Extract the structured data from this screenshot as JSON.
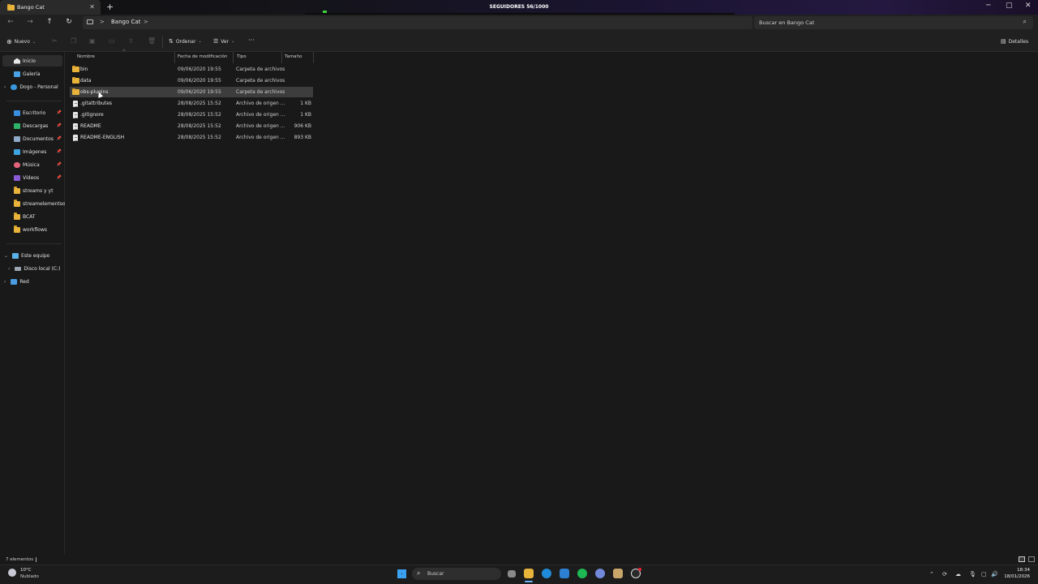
{
  "window": {
    "tab_title": "Bango Cat",
    "overlay_title": "SEGUIDORES 56/1000",
    "new_tab": "+",
    "tab_close": "✕",
    "minimize": "─",
    "maximize": "▢",
    "close": "✕"
  },
  "address": {
    "breadcrumb_sep1": ">",
    "breadcrumb_folder": "Bango Cat",
    "breadcrumb_sep2": ">",
    "search_placeholder": "Buscar en Bango Cat"
  },
  "toolbar": {
    "new_label": "Nuevo",
    "sort_label": "Ordenar",
    "view_label": "Ver",
    "more_label": "···",
    "details_label": "Detalles"
  },
  "sidebar": {
    "home": "Inicio",
    "gallery": "Galería",
    "onedrive": "Dogo - Personal",
    "quick": [
      {
        "label": "Escritorio",
        "pinned": true,
        "icon": "desktop-icon"
      },
      {
        "label": "Descargas",
        "pinned": true,
        "icon": "download-icon"
      },
      {
        "label": "Documentos",
        "pinned": true,
        "icon": "documents-icon"
      },
      {
        "label": "Imágenes",
        "pinned": true,
        "icon": "pictures-icon"
      },
      {
        "label": "Música",
        "pinned": true,
        "icon": "music-icon"
      },
      {
        "label": "Vídeos",
        "pinned": true,
        "icon": "videos-icon"
      },
      {
        "label": "streams y yt",
        "pinned": false,
        "icon": "folder-icon"
      },
      {
        "label": "streamelementsove",
        "pinned": false,
        "icon": "folder-icon"
      },
      {
        "label": "BCAT",
        "pinned": false,
        "icon": "folder-icon"
      },
      {
        "label": "workflows",
        "pinned": false,
        "icon": "folder-icon"
      }
    ],
    "this_pc": "Este equipo",
    "local_disk": "Disco local (C:)",
    "network": "Red"
  },
  "columns": {
    "name": "Nombre",
    "modified": "Fecha de modificación",
    "type": "Tipo",
    "size": "Tamaño"
  },
  "files": [
    {
      "name": "bin",
      "modified": "09/06/2020 19:55",
      "type": "Carpeta de archivos",
      "size": "",
      "kind": "folder",
      "selected": false
    },
    {
      "name": "data",
      "modified": "09/06/2020 19:55",
      "type": "Carpeta de archivos",
      "size": "",
      "kind": "folder",
      "selected": false
    },
    {
      "name": "obs-plugins",
      "modified": "09/06/2020 19:55",
      "type": "Carpeta de archivos",
      "size": "",
      "kind": "folder",
      "selected": true
    },
    {
      "name": ".gitattributes",
      "modified": "28/08/2025 15:52",
      "type": "Archivo de origen ...",
      "size": "1 KB",
      "kind": "file",
      "selected": false
    },
    {
      "name": ".gitignore",
      "modified": "28/08/2025 15:52",
      "type": "Archivo de origen ...",
      "size": "1 KB",
      "kind": "file",
      "selected": false
    },
    {
      "name": "README",
      "modified": "28/08/2025 15:52",
      "type": "Archivo de origen ...",
      "size": "906 KB",
      "kind": "file",
      "selected": false
    },
    {
      "name": "README-ENGLISH",
      "modified": "28/08/2025 15:52",
      "type": "Archivo de origen ...",
      "size": "893 KB",
      "kind": "file",
      "selected": false
    }
  ],
  "status": {
    "count": "7 elementos"
  },
  "taskbar": {
    "weather_temp": "10°C",
    "weather_desc": "Nublado",
    "search_label": "Buscar",
    "time": "18:34",
    "date": "18/01/2026"
  },
  "colors": {
    "accent": "#0078d4",
    "folder": "#e8b33a",
    "selection": "#3d3d3d"
  }
}
